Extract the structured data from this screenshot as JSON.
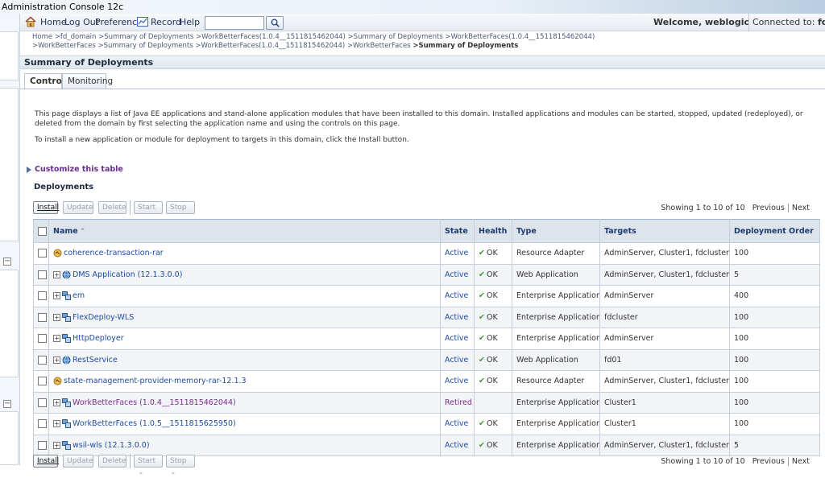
{
  "window": {
    "title": "Administration Console 12c"
  },
  "topbar": {
    "home": "Home",
    "logout": "Log Out",
    "preferences": "Preferences",
    "record": "Record",
    "help": "Help",
    "search_value": "",
    "welcome": "Welcome, weblogic",
    "connected_prefix": "Connected to:",
    "connected_domain": "fd_domain"
  },
  "breadcrumb": {
    "items": [
      "Home",
      ">fd_domain",
      ">Summary of Deployments",
      ">WorkBetterFaces(1.0.4__1511815462044)",
      ">Summary of Deployments",
      ">WorkBetterFaces(1.0.4__1511815462044)",
      ">WorkBetterFaces",
      ">Summary of Deployments",
      ">WorkBetterFaces(1.0.4__1511815462044)",
      ">WorkBetterFaces"
    ],
    "current": ">Summary of Deployments"
  },
  "page": {
    "title": "Summary of Deployments"
  },
  "tabs": [
    {
      "label": "Control"
    },
    {
      "label": "Monitoring"
    }
  ],
  "description": {
    "p1": "This page displays a list of Java EE applications and stand-alone application modules that have been installed to this domain. Installed applications and modules can be started, stopped, updated (redeployed), or deleted from the domain by first selecting the application name and using the controls on this page.",
    "p2": "To install a new application or module for deployment to targets in this domain, click the Install button."
  },
  "customize_link": "Customize this table",
  "deployments": {
    "heading": "Deployments",
    "buttons": {
      "install": "Install",
      "update": "Update",
      "delete": "Delete",
      "start": "Start",
      "stop": "Stop"
    },
    "pager": {
      "showing": "Showing 1 to 10 of 10",
      "previous": "Previous",
      "next": "Next"
    },
    "columns": {
      "name": "Name",
      "state": "State",
      "health": "Health",
      "type": "Type",
      "targets": "Targets",
      "order": "Deployment Order"
    },
    "rows": [
      {
        "name": "coherence-transaction-rar",
        "state": "Active",
        "health": "OK",
        "type": "Resource Adapter",
        "targets": "AdminServer, Cluster1, fdcluster",
        "order": "100",
        "expand": false,
        "icon": "resource-adapter-icon"
      },
      {
        "name": "DMS Application (12.1.3.0.0)",
        "state": "Active",
        "health": "OK",
        "type": "Web Application",
        "targets": "AdminServer, Cluster1, fdcluster",
        "order": "5",
        "expand": true,
        "icon": "web-app-icon"
      },
      {
        "name": "em",
        "state": "Active",
        "health": "OK",
        "type": "Enterprise Application",
        "targets": "AdminServer",
        "order": "400",
        "expand": true,
        "icon": "enterprise-app-icon"
      },
      {
        "name": "FlexDeploy-WLS",
        "state": "Active",
        "health": "OK",
        "type": "Enterprise Application",
        "targets": "fdcluster",
        "order": "100",
        "expand": true,
        "icon": "enterprise-app-icon"
      },
      {
        "name": "HttpDeployer",
        "state": "Active",
        "health": "OK",
        "type": "Enterprise Application",
        "targets": "AdminServer",
        "order": "100",
        "expand": true,
        "icon": "enterprise-app-icon"
      },
      {
        "name": "RestService",
        "state": "Active",
        "health": "OK",
        "type": "Web Application",
        "targets": "fd01",
        "order": "100",
        "expand": true,
        "icon": "web-app-icon"
      },
      {
        "name": "state-management-provider-memory-rar-12.1.3",
        "state": "Active",
        "health": "OK",
        "type": "Resource Adapter",
        "targets": "AdminServer, Cluster1, fdcluster",
        "order": "100",
        "expand": false,
        "icon": "resource-adapter-icon"
      },
      {
        "name": "WorkBetterFaces (1.0.4__1511815462044)",
        "state": "Retired",
        "health": "",
        "type": "Enterprise Application",
        "targets": "Cluster1",
        "order": "100",
        "expand": true,
        "icon": "enterprise-app-icon"
      },
      {
        "name": "WorkBetterFaces (1.0.5__1511815625950)",
        "state": "Active",
        "health": "OK",
        "type": "Enterprise Application",
        "targets": "Cluster1",
        "order": "100",
        "expand": true,
        "icon": "enterprise-app-icon"
      },
      {
        "name": "wsil-wls (12.1.3.0.0)",
        "state": "Active",
        "health": "OK",
        "type": "Enterprise Application",
        "targets": "AdminServer, Cluster1, fdcluster",
        "order": "5",
        "expand": true,
        "icon": "enterprise-app-icon"
      }
    ]
  }
}
